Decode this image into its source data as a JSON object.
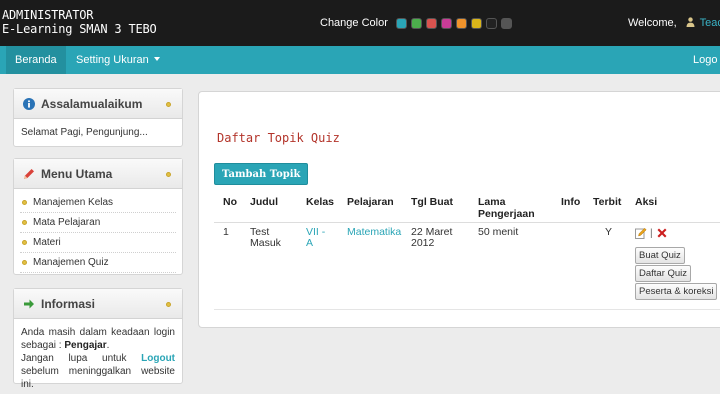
{
  "brand": {
    "line1": "ADMINISTRATOR",
    "line2": "E-Learning SMAN 3 TEBO"
  },
  "theme": {
    "label": "Change Color",
    "swatches": [
      "#2aa5b6",
      "#4cae4c",
      "#d9534f",
      "#c93c97",
      "#f0932b",
      "#d9b51a",
      "#222222",
      "#555555"
    ]
  },
  "welcome": {
    "label": "Welcome,",
    "user": "Teach"
  },
  "nav": {
    "home": "Beranda",
    "setting": "Setting Ukuran",
    "logout": "Logo"
  },
  "panels": {
    "greeting": {
      "title": "Assalamualaikum",
      "text": "Selamat Pagi, Pengunjung..."
    },
    "menu": {
      "title": "Menu Utama",
      "items": [
        "Manajemen Kelas",
        "Mata Pelajaran",
        "Materi",
        "Manajemen Quiz"
      ]
    },
    "info": {
      "title": "Informasi",
      "t1": "Anda masih dalam keadaan login sebagai :",
      "role": "Pengajar",
      "t2": "Jangan lupa untuk",
      "logout": "Logout",
      "t3": "sebelum meninggalkan website ini."
    }
  },
  "main": {
    "title": "Daftar Topik Quiz",
    "add_button": "Tambah Topik",
    "headers": {
      "no": "No",
      "judul": "Judul",
      "kelas": "Kelas",
      "pelajaran": "Pelajaran",
      "tgl": "Tgl Buat",
      "lama1": "Lama",
      "lama2": "Pengerjaan",
      "info": "Info",
      "terbit": "Terbit",
      "aksi": "Aksi"
    },
    "row": {
      "no": "1",
      "judul1": "Test",
      "judul2": "Masuk",
      "kelas1": "VII -",
      "kelas2": "A",
      "pelajaran": "Matematika",
      "tgl1": "22 Maret",
      "tgl2": "2012",
      "lama": "50 menit",
      "info": "",
      "terbit": "Y"
    },
    "actions": {
      "sep": "|",
      "buat": "Buat Quiz",
      "daftar": "Daftar Quiz",
      "peserta": "Peserta & koreksi"
    }
  }
}
